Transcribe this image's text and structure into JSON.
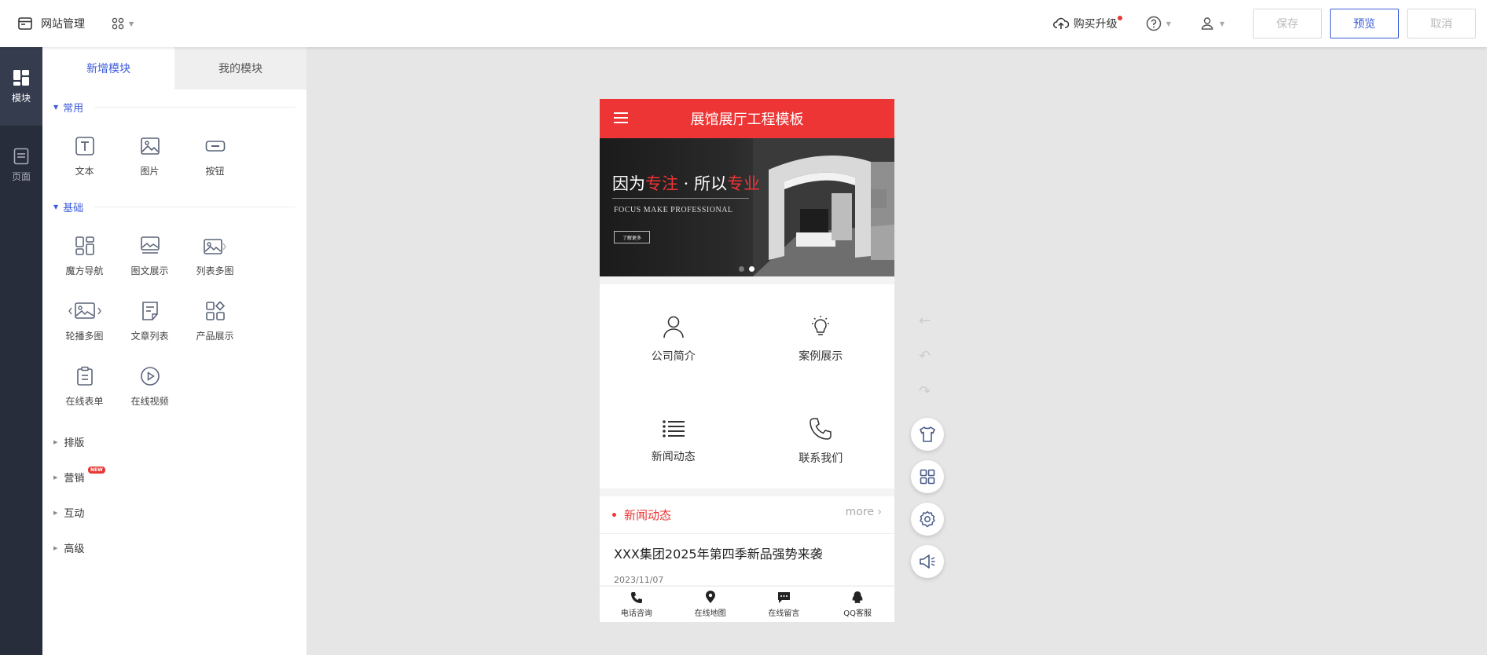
{
  "topbar": {
    "site_title": "网站管理",
    "upgrade_label": "购买升级",
    "save_label": "保存",
    "preview_label": "预览",
    "cancel_label": "取消"
  },
  "rail": {
    "items": [
      {
        "label": "模块",
        "icon": "modules-icon"
      },
      {
        "label": "页面",
        "icon": "page-icon"
      }
    ]
  },
  "panel": {
    "tabs": [
      "新增模块",
      "我的模块"
    ],
    "sections": {
      "common": {
        "label": "常用",
        "items": [
          "文本",
          "图片",
          "按钮"
        ]
      },
      "basic": {
        "label": "基础",
        "items": [
          "魔方导航",
          "图文展示",
          "列表多图",
          "轮播多图",
          "文章列表",
          "产品展示",
          "在线表单",
          "在线视频"
        ]
      }
    },
    "collapsed": [
      "排版",
      "营销",
      "互动",
      "高级"
    ],
    "new_badge": "NEW"
  },
  "phone": {
    "title": "展馆展厅工程模板",
    "banner": {
      "slogan_a": "因为",
      "slogan_b": "专注",
      "slogan_c": " · 所以",
      "slogan_d": "专业",
      "subtitle": "FOCUS MAKE PROFESSIONAL",
      "more": "了解更多"
    },
    "nav": [
      "公司简介",
      "案例展示",
      "新闻动态",
      "联系我们"
    ],
    "news": {
      "heading": "新闻动态",
      "more": "more",
      "item_title": "XXX集团2025年第四季新品强势来袭",
      "item_date": "2023/11/07"
    },
    "bottom": [
      "电话咨询",
      "在线地图",
      "在线留言",
      "QQ客服"
    ]
  },
  "colors": {
    "accent": "#3b5bdb",
    "theme_red": "#ee3535",
    "rail_bg": "#272d3b"
  }
}
